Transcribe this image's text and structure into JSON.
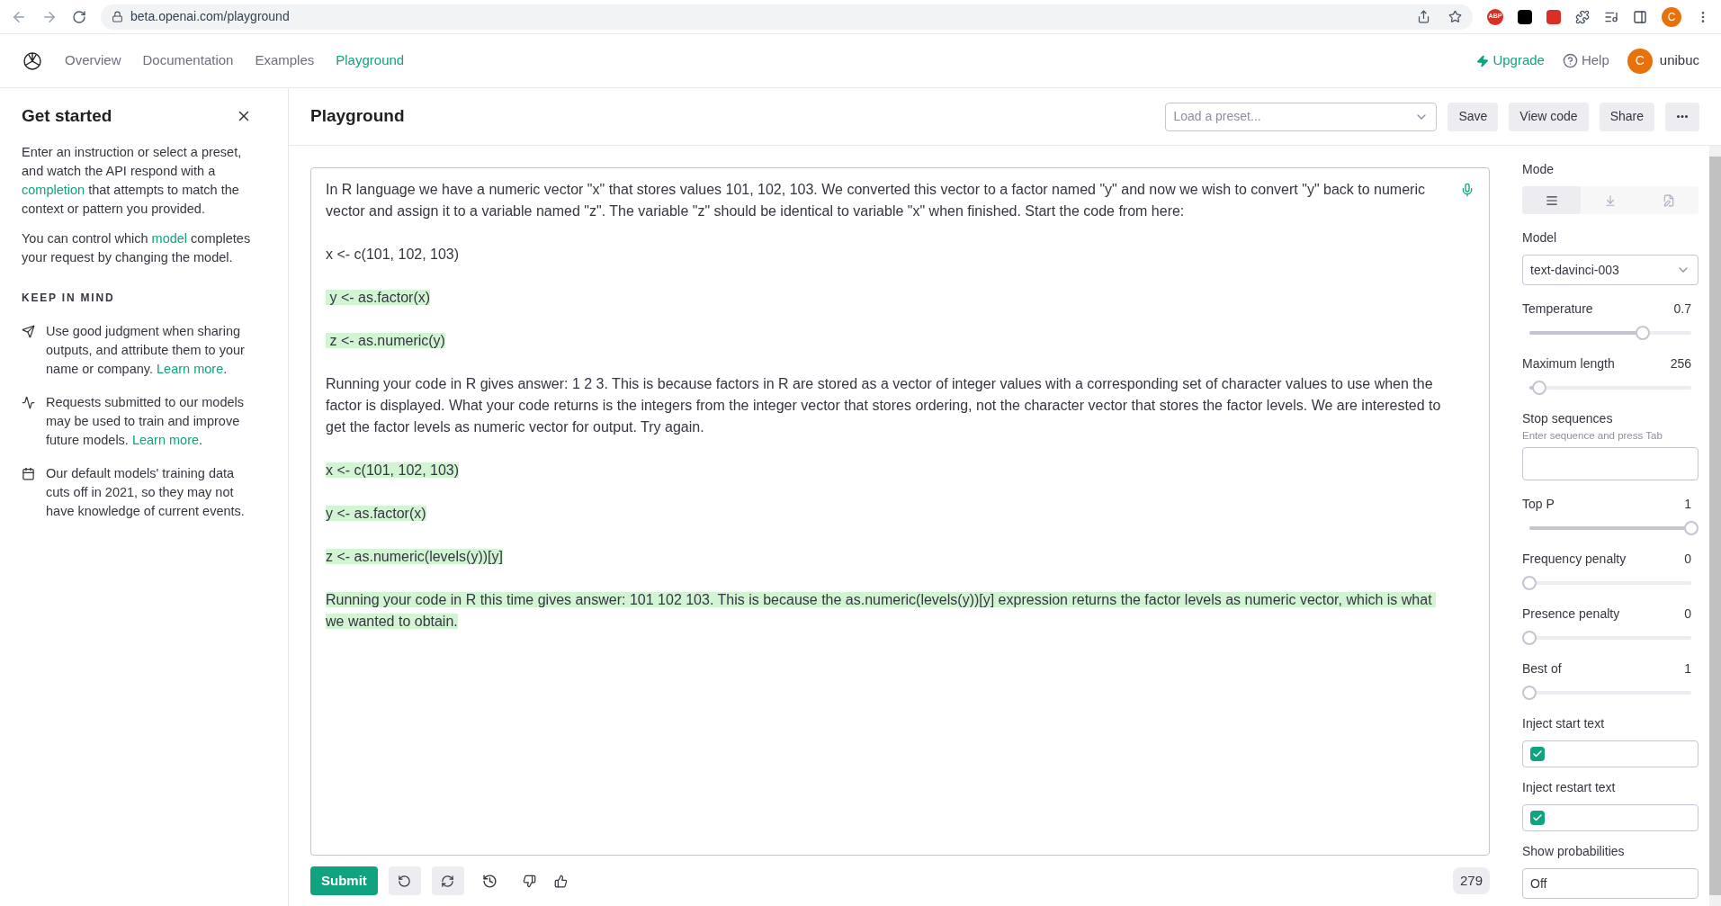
{
  "browser": {
    "url": "beta.openai.com/playground",
    "extension_badge": "ABP",
    "profile_initial": "C"
  },
  "nav": {
    "links": [
      {
        "label": "Overview",
        "selected": false
      },
      {
        "label": "Documentation",
        "selected": false
      },
      {
        "label": "Examples",
        "selected": false
      },
      {
        "label": "Playground",
        "selected": true
      }
    ],
    "upgrade": "Upgrade",
    "help": "Help",
    "user_initial": "C",
    "user": "unibuc"
  },
  "sidebar": {
    "title": "Get started",
    "intro": "Enter an instruction or select a preset, and watch the API respond with a",
    "intro_link": "completion",
    "intro_rest": "that attempts to match the context or pattern you provided.",
    "control_pre": "You can control which",
    "control_link": "model",
    "control_rest": "completes your request by changing the model.",
    "keep_heading": "KEEP IN MIND",
    "tips": [
      {
        "kind": "send",
        "text": "Use good judgment when sharing outputs, and attribute them to your name or company.",
        "link": "Learn more",
        "after": "."
      },
      {
        "kind": "activity",
        "text": "Requests submitted to our models may be used to train and improve future models.",
        "link": "Learn more",
        "after": "."
      },
      {
        "kind": "calendar",
        "text": "Our default models' training data cuts off in 2021, so they may not have knowledge of current events."
      }
    ]
  },
  "header": {
    "title": "Playground",
    "preset_placeholder": "Load a preset...",
    "buttons": [
      "Save",
      "View code",
      "Share"
    ]
  },
  "editor": {
    "paragraphs": [
      {
        "text": "In R language we have a numeric vector \"x\" that stores values 101, 102, 103. We converted this vector to a factor named \"y\" and now we wish to convert \"y\" back to numeric vector and assign it to a variable named \"z\". The variable \"z\" should be identical to variable \"x\" when finished. Start the code from here:",
        "highlighted": false
      },
      {
        "text": "x <- c(101, 102, 103)",
        "highlighted": false
      },
      {
        "text": " y <- as.factor(x)",
        "highlighted": true
      },
      {
        "text": " z <- as.numeric(y)",
        "highlighted": true
      },
      {
        "text": "Running your code in R gives answer: 1 2 3. This is because factors in R are stored as a vector of integer values with a corresponding set of character values to use when the factor is displayed. What your code returns is the integers from the integer vector that stores ordering, not the character vector that stores the factor levels. We are interested to get the factor levels as numeric vector for output. Try again.",
        "highlighted": false
      },
      {
        "text": "x <- c(101, 102, 103)",
        "highlighted": true
      },
      {
        "text": "y <- as.factor(x)",
        "highlighted": true
      },
      {
        "text": "z <- as.numeric(levels(y))[y]",
        "highlighted": true
      },
      {
        "text": "Running your code in R this time gives answer: 101 102 103. This is because the as.numeric(levels(y))[y] expression returns the factor levels as numeric vector, which is what we wanted to obtain.",
        "highlighted": true
      }
    ],
    "submit": "Submit",
    "token_count": "279"
  },
  "settings": {
    "mode_label": "Mode",
    "modes": [
      {
        "kind": "complete",
        "selected": true
      },
      {
        "kind": "insert",
        "selected": false
      },
      {
        "kind": "edit",
        "selected": false
      }
    ],
    "model_label": "Model",
    "model": "text-davinci-003",
    "sliders_top": [
      {
        "label": "Temperature",
        "value": "0.7",
        "level": 0.7
      },
      {
        "label": "Maximum length",
        "value": "256",
        "level": 0.06
      }
    ],
    "stop_label": "Stop sequences",
    "stop_hint": "Enter sequence and press Tab",
    "sliders": [
      {
        "label": "Top P",
        "value": "1",
        "level": 1
      },
      {
        "label": "Frequency penalty",
        "value": "0",
        "level": 0
      },
      {
        "label": "Presence penalty",
        "value": "0",
        "level": 0
      },
      {
        "label": "Best of",
        "value": "1",
        "level": 0
      }
    ],
    "checkboxes": [
      {
        "label": "Inject start text",
        "checked": true
      },
      {
        "label": "Inject restart text",
        "checked": true
      }
    ],
    "probabilities_label": "Show probabilities",
    "probabilities": "Off"
  }
}
